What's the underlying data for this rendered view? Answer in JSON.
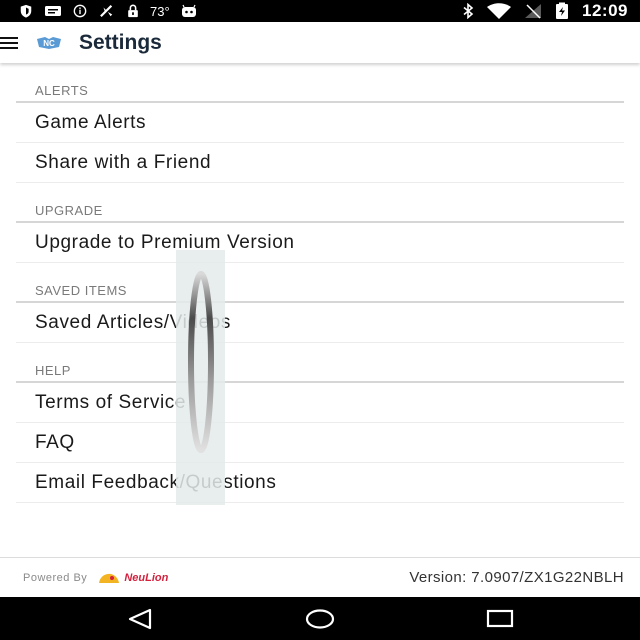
{
  "status_bar": {
    "temperature": "73°",
    "time": "12:09",
    "icons": [
      "shield-icon",
      "message-icon",
      "info-icon",
      "fan-icon",
      "lock-icon",
      "android-icon",
      "bluetooth-icon",
      "wifi-icon",
      "no-signal-icon",
      "battery-icon"
    ]
  },
  "app_bar": {
    "title": "Settings",
    "menu_icon": "hamburger-icon",
    "logo_icon": "team-logo-icon",
    "logo_color": "#5b9bd5"
  },
  "sections": [
    {
      "header": "ALERTS",
      "items": [
        "Game Alerts",
        "Share with a Friend"
      ]
    },
    {
      "header": "UPGRADE",
      "items": [
        "Upgrade to Premium Version"
      ]
    },
    {
      "header": "SAVED ITEMS",
      "items": [
        "Saved Articles/Videos"
      ]
    },
    {
      "header": "HELP",
      "items": [
        "Terms of Service",
        "FAQ",
        "Email Feedback/Questions"
      ]
    }
  ],
  "footer": {
    "powered_by": "Powered By",
    "brand": "NeuLion",
    "version": "Version: 7.0907/ZX1G22NBLH"
  },
  "nav_bar": {
    "back_icon": "back-triangle-icon",
    "home_icon": "home-circle-icon",
    "recents_icon": "recents-square-icon"
  },
  "colors": {
    "status_bar_bg": "#000000",
    "title_text": "#1b2a3a",
    "section_header_text": "#7a7a7a",
    "brand_red": "#d4213d"
  }
}
